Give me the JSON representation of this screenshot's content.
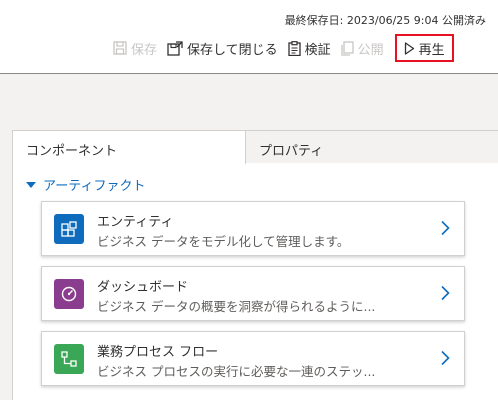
{
  "header": {
    "saved_status": "最終保存日: 2023/06/25 9:04 公開済み"
  },
  "toolbar": {
    "save_label": "保存",
    "save_close_label": "保存して閉じる",
    "validate_label": "検証",
    "publish_label": "公開",
    "play_label": "再生",
    "highlight_color": "#e81123"
  },
  "tabs": [
    {
      "label": "コンポーネント",
      "active": true
    },
    {
      "label": "プロパティ",
      "active": false
    }
  ],
  "section": {
    "title": "アーティファクト"
  },
  "cards": [
    {
      "title": "エンティティ",
      "description": "ビジネス データをモデル化して管理します。",
      "icon": "entity-icon",
      "color": "#0f6cbd"
    },
    {
      "title": "ダッシュボード",
      "description": "ビジネス データの概要を洞察が得られるように...",
      "icon": "dashboard-icon",
      "color": "#8a3c8f"
    },
    {
      "title": "業務プロセス フロー",
      "description": "ビジネス プロセスの実行に必要な一連のステッ...",
      "icon": "flow-icon",
      "color": "#3aa757"
    }
  ]
}
